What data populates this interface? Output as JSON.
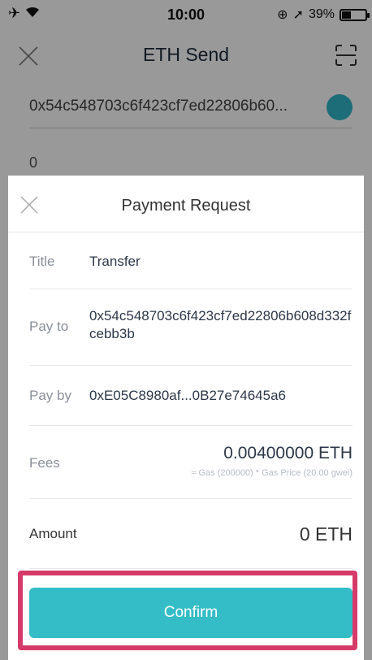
{
  "status_bar": {
    "time": "10:00",
    "battery": "39%",
    "battery_level": 0.39
  },
  "nav": {
    "title": "ETH Send"
  },
  "send_form": {
    "address": "0x54c548703c6f423cf7ed22806b60...",
    "amount": "0"
  },
  "payment_request": {
    "title": "Payment Request",
    "title_label": "Title",
    "title_value": "Transfer",
    "pay_to_label": "Pay to",
    "pay_to_value": "0x54c548703c6f423cf7ed22806b608d332fcebb3b",
    "pay_by_label": "Pay by",
    "pay_by_value": "0xE05C8980af...0B27e74645a6",
    "fees_label": "Fees",
    "fees_value": "0.00400000 ETH",
    "fees_detail": "≈ Gas (200000) * Gas Price (20.00 gwei)",
    "amount_label": "Amount",
    "amount_value": "0 ETH",
    "confirm_label": "Confirm"
  },
  "colors": {
    "accent": "#34bdc7",
    "highlight": "#d63a6a"
  }
}
